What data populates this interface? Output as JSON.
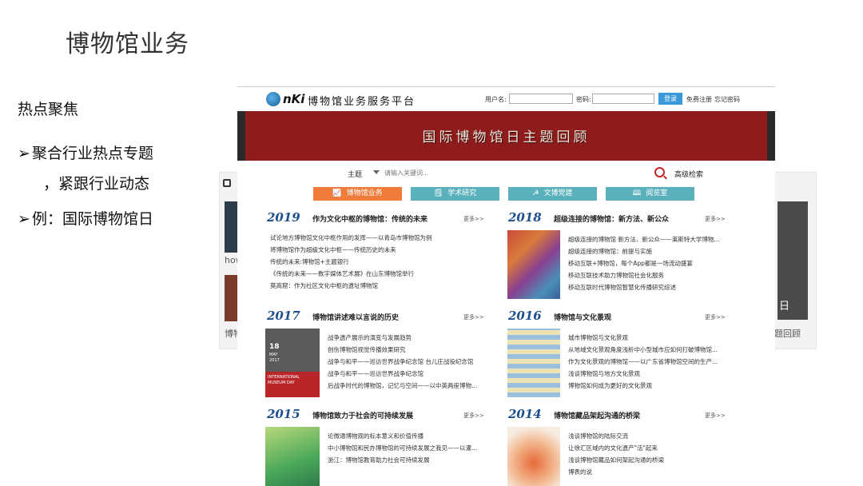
{
  "slide": {
    "title": "博物馆业务",
    "section_heading": "热点聚焦",
    "bullets": [
      {
        "text": "聚合行业热点专题",
        "cont": "，紧跟行业动态"
      },
      {
        "text": "例：国际博物馆日"
      }
    ]
  },
  "background_shot": {
    "labels": [
      "how",
      "博物",
      "日",
      "题回顾"
    ]
  },
  "site": {
    "logo_text": "nKi",
    "platform_name": "博物馆业务服务平台",
    "username_label": "用户名:",
    "password_label": "密码:",
    "login_label": "登录",
    "register_label": "免费注册",
    "forgot_label": "忘记密码"
  },
  "banner": {
    "title": "国际博物馆日主题回顾"
  },
  "search": {
    "type": "主题",
    "placeholder": "请输入关键词...",
    "advanced_label": "高级检索"
  },
  "nav": [
    {
      "label": "博物馆业务",
      "icon": "trend-icon",
      "glyph": "📈",
      "color": "#f07c3c"
    },
    {
      "label": "学术研究",
      "icon": "document-icon",
      "glyph": "🗒",
      "color": "#5ab1bb"
    },
    {
      "label": "文博党建",
      "icon": "party-flag-icon",
      "glyph": "☭",
      "color": "#5ab1bb"
    },
    {
      "label": "阅览室",
      "icon": "book-icon",
      "glyph": "🕮",
      "color": "#5ab1bb"
    }
  ],
  "more_label": "更多>>",
  "sections": [
    {
      "year": "2019",
      "title": "作为文化中枢的博物馆：传统的未来",
      "items": [
        "试论地方博物馆文化中枢作用的发挥——以青岛市博物馆为例",
        "将博物馆作为超級文化中枢——传统历史的未来",
        "传统的未来:博物馆+主题银行",
        "《传统的未来——数字媒体艺术展》在山东博物馆举行",
        "莫高窟：作为社区文化中枢的遗址博物馆"
      ]
    },
    {
      "year": "2018",
      "title": "超级连接的博物馆：新方法、新公众",
      "items": [
        "超级连接的博物馆 新方法、新公众——莱斯特大学博物...",
        "超级连接的博物馆：前提与实施",
        "移动互联+博物馆，每个App都是一场流动盛宴",
        "移动互联技术助力博物馆社会化服务",
        "移动互联时代博物馆智慧化传播研究综述"
      ]
    },
    {
      "year": "2017",
      "title": "博物馆讲述难以言说的历史",
      "items": [
        "战争遗产展示的演变与发展趋势",
        "创伤博物馆视觉传播效果研究",
        "战争与和平——巡访世界战争纪念馆 台儿庄战役纪念馆",
        "战争与和平——巡访世界战争纪念馆",
        "后战争时代的博物馆，记忆与空间——以中英两座博物..."
      ],
      "thumb_text": [
        "18",
        "MAY",
        "2017",
        "INTERNATIONAL",
        "MUSEUM DAY"
      ]
    },
    {
      "year": "2016",
      "title": "博物馆与文化景观",
      "items": [
        "城市博物馆与文化景观",
        "从地域文化景观角度浅析中小型城市应如何打破博物馆...",
        "作为文化景观的博物馆——以广东省博物馆空间的生产...",
        "浅谈博物馆与地方文化景观",
        "博物馆如何成为更好的文化景观"
      ]
    },
    {
      "year": "2015",
      "title": "博物馆致力于社会的可持续发展",
      "items": [
        "论微通博物观的标本意义和价值传播",
        "中小博物馆和民办博物馆的可持续发展之我见——以灌...",
        "浙江：博物馆教育助力社会可持续发展"
      ]
    },
    {
      "year": "2014",
      "title": "博物馆藏品架起沟通的桥梁",
      "items": [
        "浅谈博物馆的陆际交流",
        "让徐汇区域内的文化遗产\"活\"起来",
        "浅谈博物馆藏品如何架起沟通的桥梁",
        "博表的说"
      ]
    }
  ]
}
